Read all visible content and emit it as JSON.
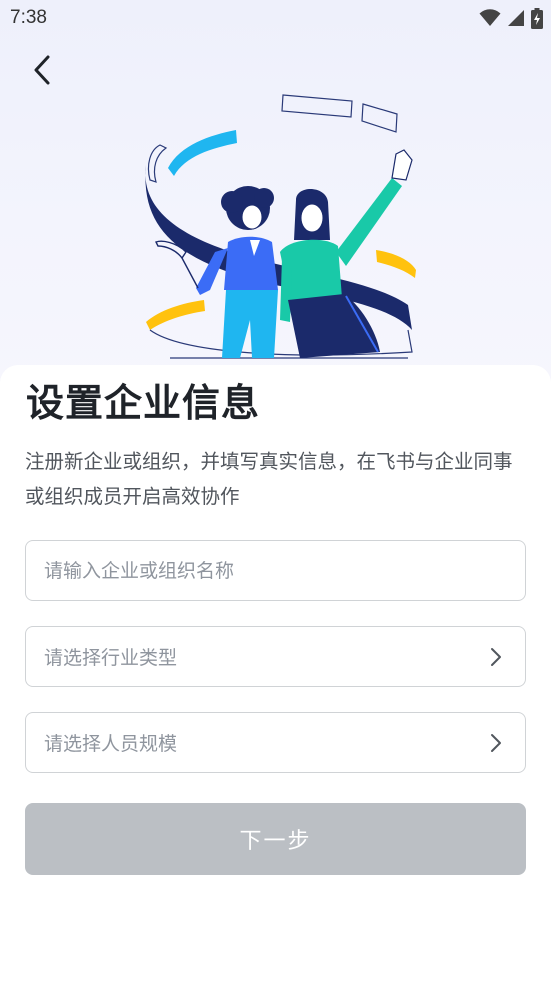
{
  "status_bar": {
    "time": "7:38",
    "icons": [
      "wifi-icon",
      "cellular-signal-icon",
      "battery-charging-icon"
    ]
  },
  "navigation": {
    "back_icon": "chevron-left-icon"
  },
  "illustration": {
    "colors": {
      "ribbon_navy": "#1b2a6b",
      "ribbon_cyan": "#1fb6f0",
      "ribbon_yellow": "#ffc20e",
      "person_blue": "#3b6cf6",
      "person_green": "#19c9a8"
    }
  },
  "form": {
    "title": "设置企业信息",
    "description": "注册新企业或组织，并填写真实信息，在飞书与企业同事或组织成员开启高效协作",
    "org_name": {
      "placeholder": "请输入企业或组织名称",
      "value": ""
    },
    "industry": {
      "placeholder": "请选择行业类型"
    },
    "staff_size": {
      "placeholder": "请选择人员规模"
    },
    "next_button": "下一步"
  },
  "colors": {
    "title": "#1f2329",
    "body_text": "#51565d",
    "placeholder": "#8f959e",
    "border": "#d0d3d6",
    "button_disabled": "#bbbfc4"
  }
}
